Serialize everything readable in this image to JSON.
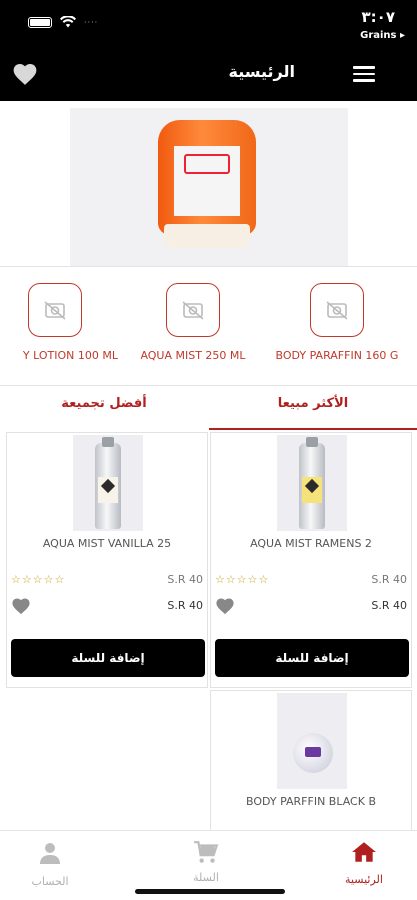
{
  "status_bar": {
    "time": "٣:٠٧",
    "carrier": "Grains ▸",
    "signal_dots": "····"
  },
  "header": {
    "title": "الرئيسية"
  },
  "categories": [
    {
      "label": "BODY PARAFFIN 160 G"
    },
    {
      "label": "AQUA MIST 250 ML"
    },
    {
      "label": "Y LOTION 100 ML"
    }
  ],
  "tabs": [
    {
      "label": "الأكثر مبيعا",
      "active": true
    },
    {
      "label": "أفضل تجميعة",
      "active": false
    }
  ],
  "products": [
    {
      "name": "AQUA MIST  RAMENS  2",
      "stars": "☆☆☆☆☆",
      "price_old": "S.R 40",
      "price": "S.R 40",
      "add_label": "إضافة للسلة"
    },
    {
      "name": "AQUA MIST VANILLA 25",
      "stars": "☆☆☆☆☆",
      "price_old": "S.R 40",
      "price": "S.R 40",
      "add_label": "إضافة للسلة"
    },
    {
      "name": "BODY PARFFIN BLACK B"
    }
  ],
  "bottom_nav": [
    {
      "label": "الرئيسية",
      "icon": "home-icon",
      "active": true
    },
    {
      "label": "السلة",
      "icon": "cart-icon",
      "active": false
    },
    {
      "label": "الحساب",
      "icon": "user-icon",
      "active": false
    }
  ],
  "colors": {
    "accent": "#b02020",
    "header_bg": "#000000",
    "star": "#c7a21e"
  }
}
